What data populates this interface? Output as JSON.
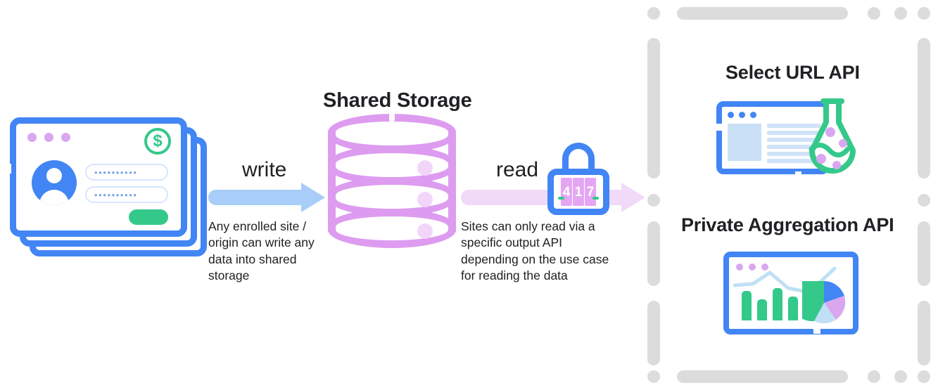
{
  "diagram": {
    "title_storage": "Shared Storage",
    "arrows": [
      {
        "label": "write",
        "caption": "Any enrolled site / origin can write any data into shared storage",
        "color": "#A7CDF8"
      },
      {
        "label": "read",
        "caption": "Sites can only read via a specific output API depending on the use case for reading the data",
        "color": "#F0DAF8"
      }
    ],
    "write_caption_lines": [
      "Any enrolled site /",
      "origin can write any",
      "data into shared",
      "storage"
    ],
    "read_caption_lines": [
      "Sites can only read via a",
      "specific output API",
      "depending on the use case",
      "for reading the data"
    ],
    "padlock": {
      "name": "padlock-icon",
      "combination": "417",
      "digits": [
        "4",
        "1",
        "7"
      ]
    },
    "login_card": {
      "dollar_symbol": "$",
      "field_1_value": "••••••••••",
      "field_2_value": "••••••••••",
      "submit_label": ""
    },
    "output_apis": [
      {
        "title": "Select URL API",
        "illustration": "browser-flask-icon"
      },
      {
        "title": "Private Aggregation API",
        "illustration": "analytics-dashboard-icon"
      }
    ],
    "colors": {
      "blue": "#4285F4",
      "light_blue": "#A7CDF8",
      "purple": "#DD9CF0",
      "light_purple": "#F0DAF8",
      "green": "#34C98A",
      "gray_dash": "#DCDCDC",
      "text": "#202124"
    }
  }
}
